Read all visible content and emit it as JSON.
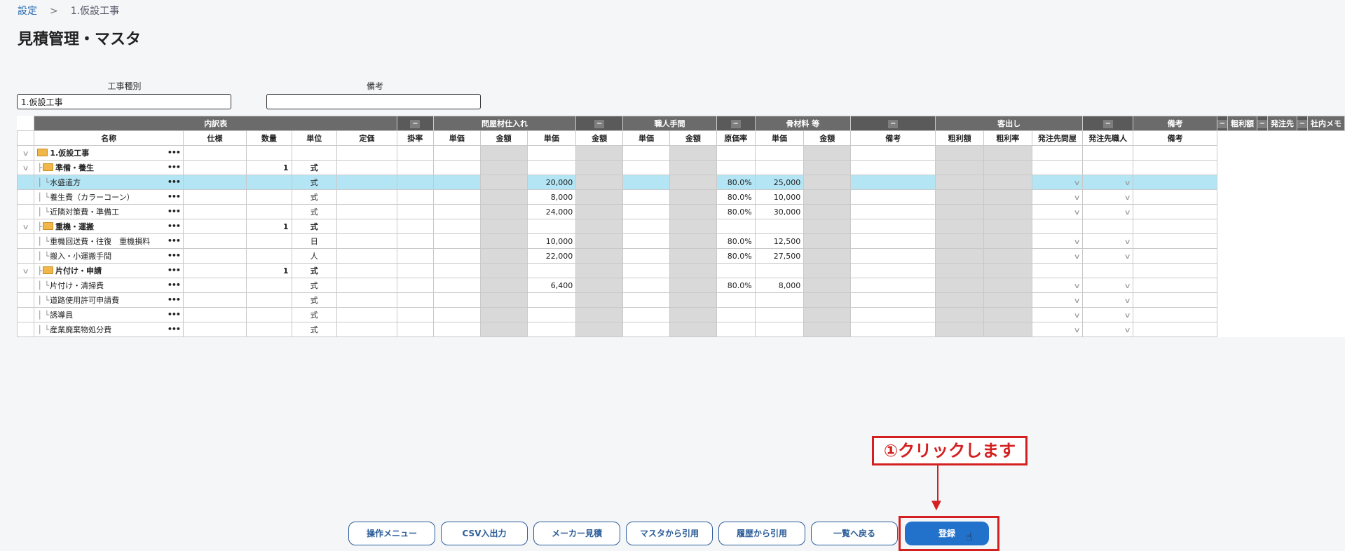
{
  "breadcrumb": {
    "root": "設定",
    "sep": ">",
    "current": "1.仮設工事"
  },
  "page_title": "見積管理・マスタ",
  "fields": {
    "kouji_label": "工事種別",
    "kouji_value": "1.仮設工事",
    "biko_label": "備考",
    "biko_value": ""
  },
  "group_headers": [
    "内訳表",
    "問屋材仕入れ",
    "職人手間",
    "骨材料 等",
    "客出し",
    "備考",
    "粗利額",
    "発注先",
    "社内メモ"
  ],
  "collapse_symbol": "−",
  "columns": [
    "名称",
    "仕様",
    "数量",
    "単位",
    "定価",
    "掛率",
    "単価",
    "金額",
    "単価",
    "金額",
    "単価",
    "金額",
    "原価率",
    "単価",
    "金額",
    "備考",
    "粗利額",
    "粗利率",
    "発注先問屋",
    "発注先職人",
    "備考"
  ],
  "rows": [
    {
      "level": 0,
      "folder": true,
      "bold": true,
      "name": "1.仮設工事",
      "qty": "",
      "unit": "",
      "labor_price": "",
      "rate": "",
      "sale_price": "",
      "toggle": true,
      "dropdowns": false
    },
    {
      "level": 1,
      "folder": true,
      "bold": true,
      "name": "準備・養生",
      "qty": "1",
      "unit": "式",
      "labor_price": "",
      "rate": "",
      "sale_price": "",
      "toggle": true,
      "dropdowns": false
    },
    {
      "level": 2,
      "folder": false,
      "bold": false,
      "name": "水盛遣方",
      "qty": "",
      "unit": "式",
      "labor_price": "20,000",
      "rate": "80.0%",
      "sale_price": "25,000",
      "toggle": false,
      "dropdowns": true,
      "selected": true
    },
    {
      "level": 2,
      "folder": false,
      "bold": false,
      "name": "養生費（カラーコーン）",
      "qty": "",
      "unit": "式",
      "labor_price": "8,000",
      "rate": "80.0%",
      "sale_price": "10,000",
      "toggle": false,
      "dropdowns": true
    },
    {
      "level": 2,
      "folder": false,
      "bold": false,
      "name": "近隣対策費・準備工",
      "qty": "",
      "unit": "式",
      "labor_price": "24,000",
      "rate": "80.0%",
      "sale_price": "30,000",
      "toggle": false,
      "dropdowns": true
    },
    {
      "level": 1,
      "folder": true,
      "bold": true,
      "name": "重機・運搬",
      "qty": "1",
      "unit": "式",
      "labor_price": "",
      "rate": "",
      "sale_price": "",
      "toggle": true,
      "dropdowns": false
    },
    {
      "level": 2,
      "folder": false,
      "bold": false,
      "name": "重機回送費・往復　重機損料",
      "qty": "",
      "unit": "日",
      "labor_price": "10,000",
      "rate": "80.0%",
      "sale_price": "12,500",
      "toggle": false,
      "dropdowns": true
    },
    {
      "level": 2,
      "folder": false,
      "bold": false,
      "name": "搬入・小運搬手間",
      "qty": "",
      "unit": "人",
      "labor_price": "22,000",
      "rate": "80.0%",
      "sale_price": "27,500",
      "toggle": false,
      "dropdowns": true
    },
    {
      "level": 1,
      "folder": true,
      "bold": true,
      "name": "片付け・申請",
      "qty": "1",
      "unit": "式",
      "labor_price": "",
      "rate": "",
      "sale_price": "",
      "toggle": true,
      "dropdowns": false
    },
    {
      "level": 2,
      "folder": false,
      "bold": false,
      "name": "片付け・清掃費",
      "qty": "",
      "unit": "式",
      "labor_price": "6,400",
      "rate": "80.0%",
      "sale_price": "8,000",
      "toggle": false,
      "dropdowns": true
    },
    {
      "level": 2,
      "folder": false,
      "bold": false,
      "name": "道路使用許可申請費",
      "qty": "",
      "unit": "式",
      "labor_price": "",
      "rate": "",
      "sale_price": "",
      "toggle": false,
      "dropdowns": true
    },
    {
      "level": 2,
      "folder": false,
      "bold": false,
      "name": "誘導員",
      "qty": "",
      "unit": "式",
      "labor_price": "",
      "rate": "",
      "sale_price": "",
      "toggle": false,
      "dropdowns": true
    },
    {
      "level": 2,
      "folder": false,
      "bold": false,
      "name": "産業廃棄物処分費",
      "qty": "",
      "unit": "式",
      "labor_price": "",
      "rate": "",
      "sale_price": "",
      "toggle": false,
      "dropdowns": true
    }
  ],
  "footer_buttons": [
    "操作メニュー",
    "CSV入出力",
    "メーカー見積",
    "マスタから引用",
    "履歴から引用",
    "一覧へ戻る"
  ],
  "primary_button": "登録",
  "callout": "①クリックします",
  "colors": {
    "primary": "#2272cc",
    "annotation": "#d42020",
    "selected_row": "#b3e5f5",
    "header_bg": "#6b6b6b"
  }
}
